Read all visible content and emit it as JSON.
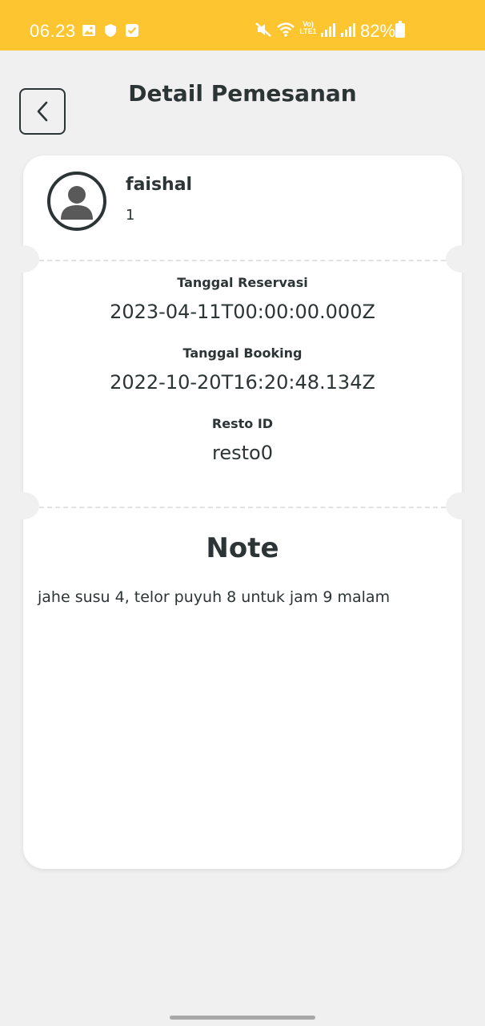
{
  "status_bar": {
    "time": "06.23",
    "network_label": "Vo) LTE1",
    "battery": "82%",
    "icons": [
      "gallery-icon",
      "shield-icon",
      "check-icon",
      "mute-icon",
      "wifi-icon",
      "signal-icon",
      "signal-icon",
      "battery-icon"
    ]
  },
  "header": {
    "title": "Detail Pemesanan"
  },
  "user": {
    "name": "faishal",
    "id": "1"
  },
  "details": {
    "reservation_label": "Tanggal Reservasi",
    "reservation_value": "2023-04-11T00:00:00.000Z",
    "booking_label": "Tanggal Booking",
    "booking_value": "2022-10-20T16:20:48.134Z",
    "resto_label": "Resto ID",
    "resto_value": "resto0"
  },
  "note": {
    "title": "Note",
    "text": "jahe susu 4, telor puyuh 8 untuk jam 9 malam"
  },
  "colors": {
    "status_bar": "#fdc630",
    "background": "#f0f0f0",
    "card": "#ffffff",
    "text": "#2d3436"
  }
}
